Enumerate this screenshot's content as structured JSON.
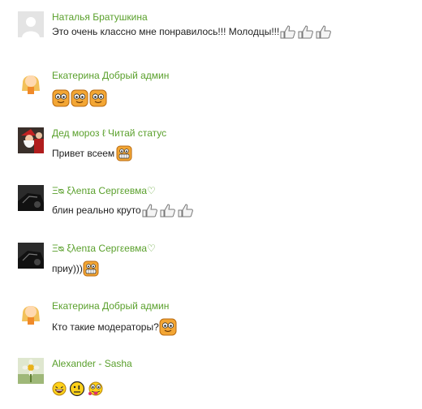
{
  "comments": [
    {
      "author": "Наталья Братушкина",
      "text": "Это очень классно мне понравилось!!! Молодцы!!!",
      "avatar": "blank-user-avatar",
      "emoticons": [
        "thumbs-up-icon",
        "thumbs-up-icon",
        "thumbs-up-icon"
      ]
    },
    {
      "author": "Екатерина Добрый админ",
      "text": "",
      "avatar": "blonde-girl-avatar",
      "emoticons": [
        "orange-face-icon",
        "orange-face-icon",
        "orange-face-icon"
      ]
    },
    {
      "author": "Дед мороз ℓ Читай статус",
      "text": "Привет всеем",
      "avatar": "santa-avatar",
      "emoticons": [
        "grin-face-icon"
      ]
    },
    {
      "author": "Ξᴓ ξλenɪa Cергεeвмa♡",
      "text": "блин реально круто",
      "avatar": "dark-car-avatar",
      "emoticons": [
        "thumbs-up-icon",
        "thumbs-up-icon",
        "thumbs-up-icon"
      ]
    },
    {
      "author": "Ξᴓ ξλenɪa Cергεeвмa♡",
      "text": "приу)))",
      "avatar": "dark-car-avatar",
      "emoticons": [
        "grin-face-icon"
      ]
    },
    {
      "author": "Екатерина Добрый админ",
      "text": "Кто такие модераторы?",
      "avatar": "blonde-girl-avatar",
      "emoticons": [
        "orange-face-icon"
      ]
    },
    {
      "author": "Alexander - Sasha",
      "text": "",
      "avatar": "flower-avatar",
      "emoticons": [
        "laughing-smiley-icon",
        "shocked-smiley-icon",
        "tongue-smiley-icon"
      ]
    }
  ],
  "colors": {
    "author_name": "#5aa02c",
    "text": "#222222",
    "background": "#ffffff"
  }
}
